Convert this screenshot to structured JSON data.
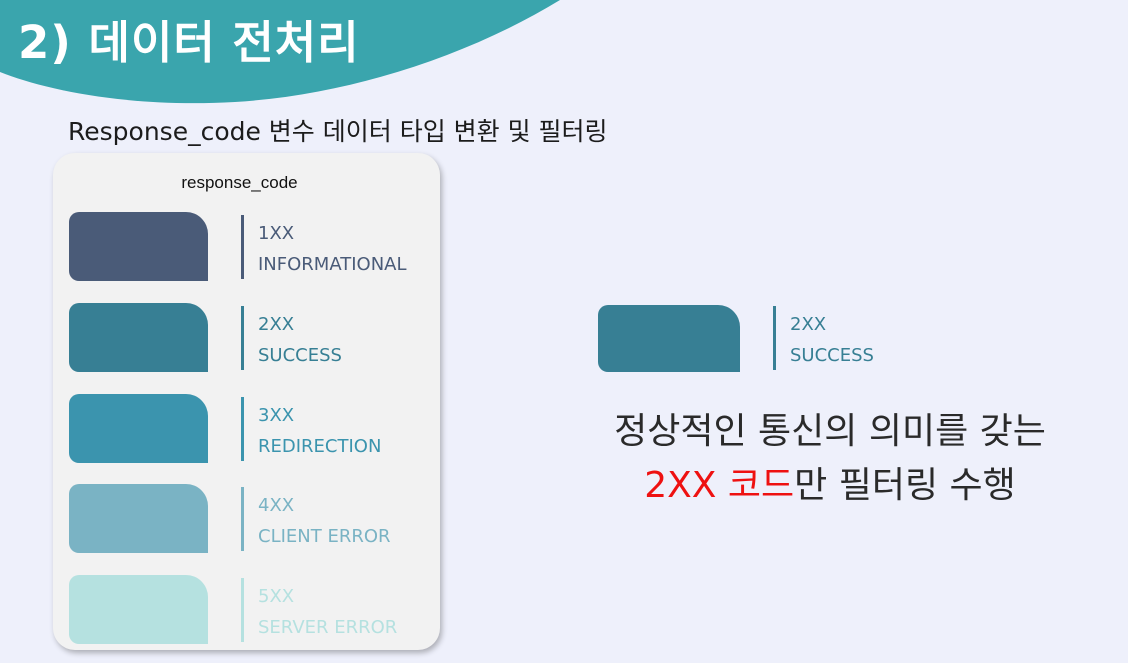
{
  "title": "2) 데이터 전처리",
  "subtitle": "Response_code 변수 데이터 타입 변환 및 필터링",
  "colors": {
    "banner": "#3aa5ad",
    "background": "#eef0fb",
    "emphasis": "#ee1111"
  },
  "legend": {
    "header": "response_code",
    "items": [
      {
        "code": "1XX",
        "desc": "INFORMATIONAL",
        "color": "#4a5b78",
        "text_color": "#4a5b78"
      },
      {
        "code": "2XX",
        "desc": "SUCCESS",
        "color": "#377f94",
        "text_color": "#377f94"
      },
      {
        "code": "3XX",
        "desc": "REDIRECTION",
        "color": "#3b94ae",
        "text_color": "#3b94ae"
      },
      {
        "code": "4XX",
        "desc": "CLIENT ERROR",
        "color": "#7ab3c4",
        "text_color": "#7ab3c4"
      },
      {
        "code": "5XX",
        "desc": "SERVER ERROR",
        "color": "#b5e1e0",
        "text_color": "#b5e1e0"
      }
    ]
  },
  "highlight": {
    "code": "2XX",
    "desc": "SUCCESS",
    "color": "#377f94"
  },
  "description": {
    "line1": "정상적인 통신의 의미를 갖는",
    "emphasis": "2XX 코드",
    "line2_rest": "만 필터링 수행"
  }
}
